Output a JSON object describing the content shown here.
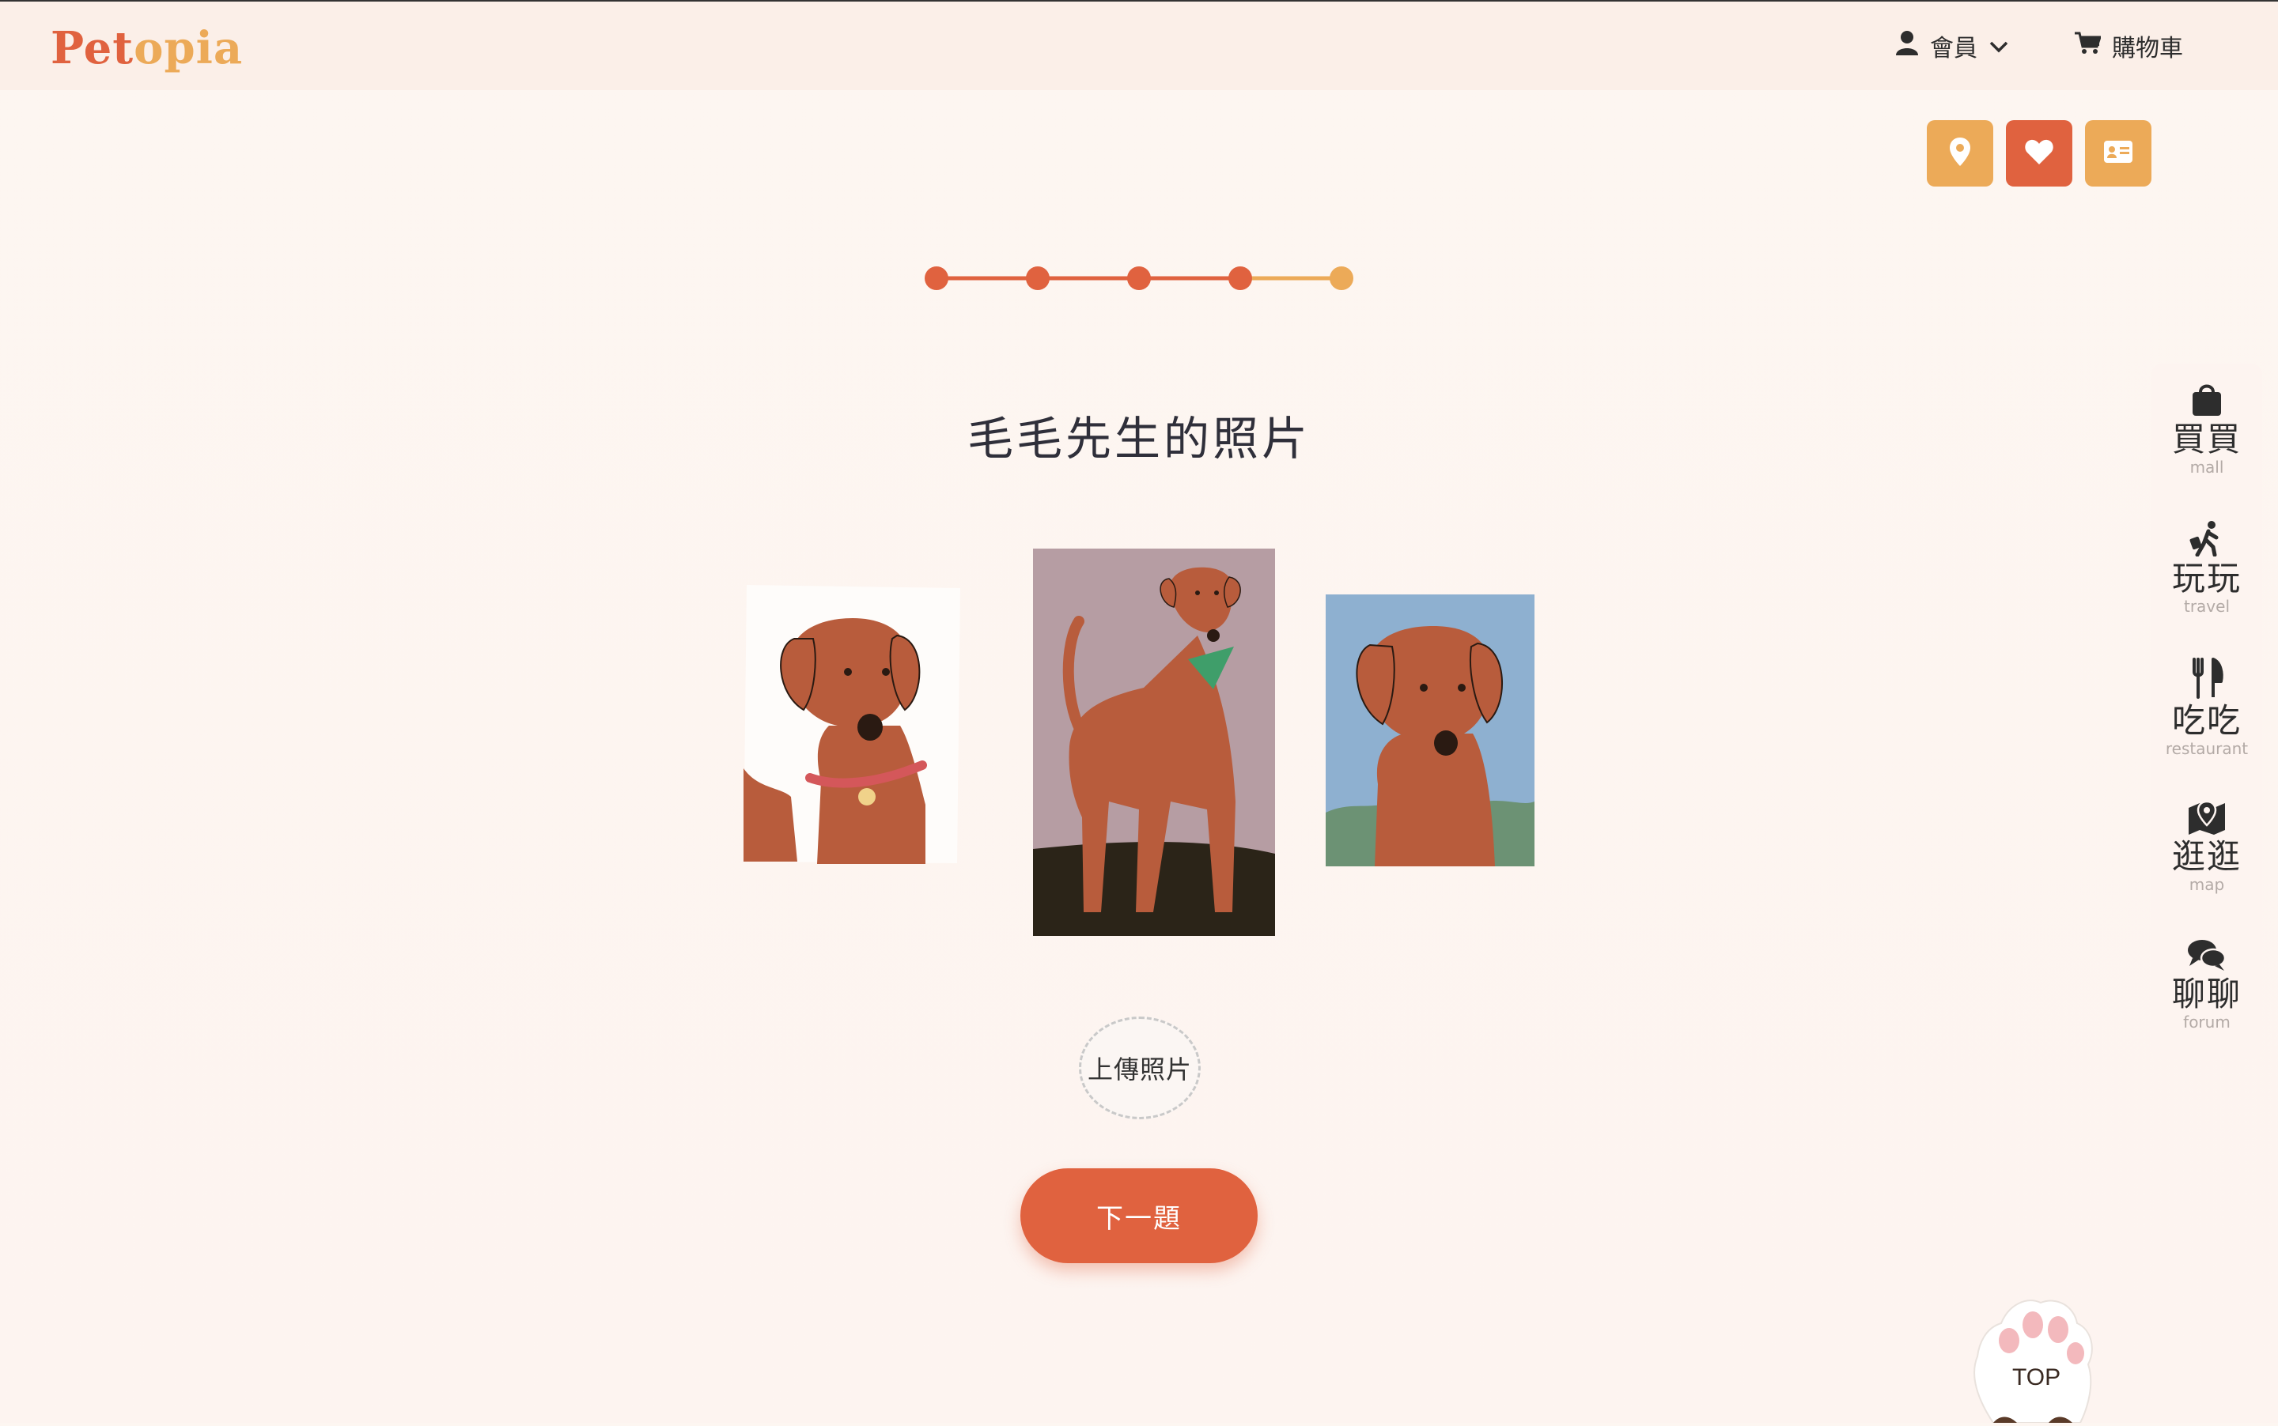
{
  "brand": {
    "logo_part1": "Pet",
    "logo_part2": "opia"
  },
  "header": {
    "member_label": "會員",
    "cart_label": "購物車"
  },
  "quick_actions": [
    {
      "icon": "location-pin-icon"
    },
    {
      "icon": "heart-icon"
    },
    {
      "icon": "id-card-icon"
    }
  ],
  "progress": {
    "total_steps": 5,
    "current_step": 5,
    "colors": {
      "done": "#e0623f",
      "current": "#ecaa58"
    }
  },
  "main": {
    "title": "毛毛先生的照片",
    "upload_label": "上傳照片",
    "next_label": "下一題"
  },
  "sidebar": {
    "items": [
      {
        "zh": "買買",
        "en": "mall",
        "icon": "shopping-bag-icon"
      },
      {
        "zh": "玩玩",
        "en": "travel",
        "icon": "walking-luggage-icon"
      },
      {
        "zh": "吃吃",
        "en": "restaurant",
        "icon": "utensils-icon"
      },
      {
        "zh": "逛逛",
        "en": "map",
        "icon": "map-pin-icon"
      },
      {
        "zh": "聊聊",
        "en": "forum",
        "icon": "chat-bubbles-icon"
      }
    ]
  },
  "top_button": {
    "label": "TOP"
  },
  "colors": {
    "accent": "#e0623f",
    "secondary": "#ecaa58",
    "dog": "#b85c3c"
  }
}
